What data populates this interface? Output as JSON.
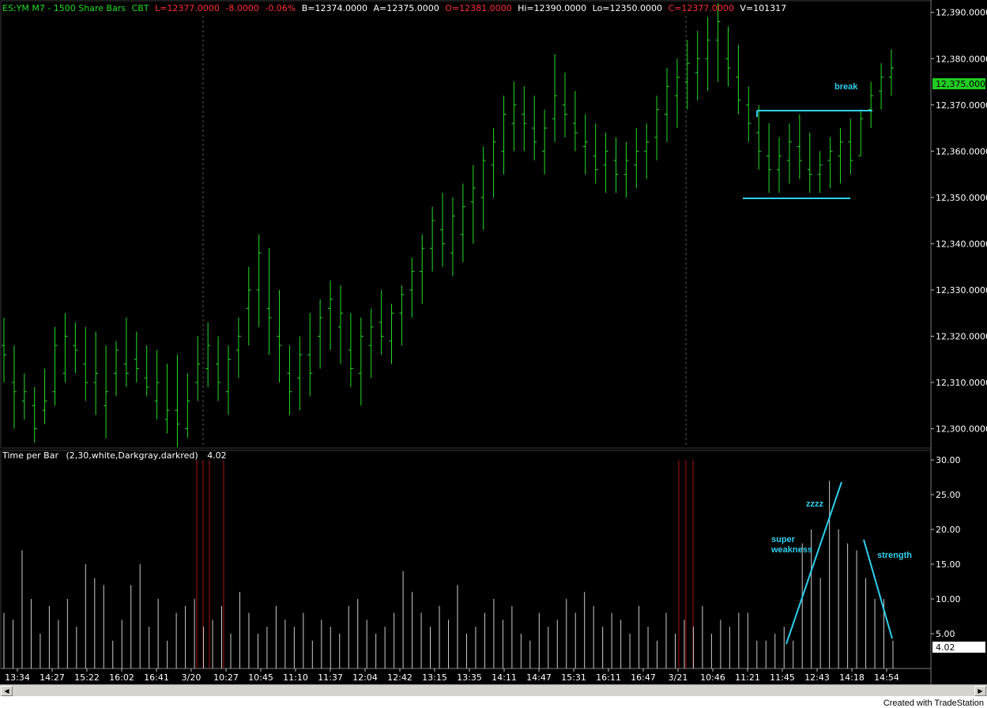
{
  "header": {
    "symbol": "ES:YM M7 - 1500 Share Bars",
    "exchange": "CBT",
    "last": "L=12377.0000",
    "change": "-8.0000",
    "change_pct": "-0.06%",
    "bid": "B=12374.0000",
    "ask": "A=12375.0000",
    "open": "O=12381.0000",
    "high": "Hi=12390.0000",
    "low": "Lo=12350.0000",
    "close": "C=12377.0000",
    "volume": "V=101317"
  },
  "indicator": {
    "label": "Time per Bar",
    "params": "(2,30,white,Darkgray,darkred)",
    "value": "4.02"
  },
  "colors": {
    "background": "#000000",
    "price_bars": "#22dd22",
    "volume_bars": "#cccccc",
    "session_break": "#aa1111",
    "annotation": "#2fd0ee",
    "header_red": "#ff3030",
    "header_green": "#22dd22",
    "last_price_tag": "#22cc22"
  },
  "annotations": {
    "break": "break",
    "zzzz": "zzzz",
    "super": "super",
    "weakness": "weakness",
    "strength": "strength"
  },
  "last_price_tag": "12,375.0000",
  "last_indicator_tag": "4.02",
  "footer": "Created with TradeStation",
  "chart_data": {
    "type": "bar",
    "price_axis": {
      "ylim": [
        12296,
        12392
      ],
      "ticks": [
        "12,390.0000",
        "12,380.0000",
        "12,370.0000",
        "12,360.0000",
        "12,350.0000",
        "12,340.0000",
        "12,330.0000",
        "12,320.0000",
        "12,310.0000",
        "12,300.0000"
      ]
    },
    "indicator_axis": {
      "ylim": [
        0,
        30
      ],
      "ticks": [
        "30.00",
        "25.00",
        "20.00",
        "15.00",
        "10.00",
        "5.00"
      ]
    },
    "time_labels": [
      "13:34",
      "14:27",
      "15:22",
      "16:02",
      "16:41",
      "3/20",
      "10:27",
      "10:45",
      "11:10",
      "11:37",
      "12:04",
      "12:42",
      "13:15",
      "13:35",
      "14:11",
      "14:47",
      "15:31",
      "16:11",
      "16:47",
      "3/21",
      "10:46",
      "11:21",
      "11:45",
      "12:43",
      "14:18",
      "14:54"
    ],
    "ohlc_series": {
      "name": "ES:YM M7",
      "bars": [
        [
          12318,
          12324,
          12310,
          12316
        ],
        [
          12310,
          12318,
          12300,
          12308
        ],
        [
          12306,
          12312,
          12302,
          12308
        ],
        [
          12305,
          12309,
          12297,
          12300
        ],
        [
          12304,
          12313,
          12301,
          12306
        ],
        [
          12308,
          12322,
          12305,
          12318
        ],
        [
          12312,
          12325,
          12310,
          12320
        ],
        [
          12318,
          12323,
          12312,
          12317
        ],
        [
          12314,
          12322,
          12306,
          12310
        ],
        [
          12310,
          12321,
          12303,
          12312
        ],
        [
          12305,
          12318,
          12298,
          12308
        ],
        [
          12312,
          12319,
          12307,
          12317
        ],
        [
          12314,
          12324,
          12309,
          12312
        ],
        [
          12315,
          12321,
          12310,
          12313
        ],
        [
          12311,
          12318,
          12307,
          12309
        ],
        [
          12306,
          12317,
          12302,
          12310
        ],
        [
          12302,
          12314,
          12299,
          12304
        ],
        [
          12304,
          12316,
          12296,
          12301
        ],
        [
          12300,
          12312,
          12298,
          12306
        ],
        [
          12310,
          12320,
          12306,
          12314
        ],
        [
          12313,
          12323,
          12309,
          12318
        ],
        [
          12314,
          12320,
          12306,
          12310
        ],
        [
          12308,
          12318,
          12303,
          12315
        ],
        [
          12317,
          12324,
          12311,
          12320
        ],
        [
          12326,
          12335,
          12318,
          12330
        ],
        [
          12330,
          12342,
          12322,
          12338
        ],
        [
          12326,
          12339,
          12316,
          12324
        ],
        [
          12320,
          12330,
          12310,
          12318
        ],
        [
          12312,
          12318,
          12303,
          12308
        ],
        [
          12311,
          12320,
          12304,
          12316
        ],
        [
          12316,
          12325,
          12307,
          12312
        ],
        [
          12320,
          12328,
          12313,
          12324
        ],
        [
          12326,
          12332,
          12317,
          12328
        ],
        [
          12322,
          12331,
          12314,
          12325
        ],
        [
          12317,
          12325,
          12309,
          12313
        ],
        [
          12312,
          12324,
          12305,
          12320
        ],
        [
          12318,
          12326,
          12311,
          12322
        ],
        [
          12323,
          12330,
          12316,
          12320
        ],
        [
          12319,
          12327,
          12314,
          12325
        ],
        [
          12325,
          12331,
          12318,
          12329
        ],
        [
          12330,
          12337,
          12324,
          12334
        ],
        [
          12334,
          12342,
          12327,
          12339
        ],
        [
          12339,
          12348,
          12334,
          12345
        ],
        [
          12343,
          12351,
          12335,
          12340
        ],
        [
          12338,
          12350,
          12333,
          12346
        ],
        [
          12342,
          12353,
          12336,
          12348
        ],
        [
          12349,
          12357,
          12340,
          12352
        ],
        [
          12350,
          12361,
          12343,
          12358
        ],
        [
          12357,
          12365,
          12350,
          12362
        ],
        [
          12360,
          12372,
          12355,
          12368
        ],
        [
          12366,
          12375,
          12360,
          12370
        ],
        [
          12368,
          12374,
          12360,
          12366
        ],
        [
          12365,
          12372,
          12358,
          12362
        ],
        [
          12360,
          12369,
          12355,
          12365
        ],
        [
          12367,
          12381,
          12362,
          12372
        ],
        [
          12370,
          12377,
          12363,
          12368
        ],
        [
          12366,
          12373,
          12360,
          12364
        ],
        [
          12361,
          12368,
          12355,
          12362
        ],
        [
          12359,
          12366,
          12353,
          12356
        ],
        [
          12357,
          12364,
          12351,
          12360
        ],
        [
          12358,
          12363,
          12351,
          12355
        ],
        [
          12355,
          12362,
          12350,
          12358
        ],
        [
          12357,
          12365,
          12352,
          12360
        ],
        [
          12360,
          12366,
          12354,
          12362
        ],
        [
          12363,
          12372,
          12358,
          12369
        ],
        [
          12368,
          12378,
          12362,
          12374
        ],
        [
          12372,
          12380,
          12365,
          12376
        ],
        [
          12375,
          12384,
          12369,
          12379
        ],
        [
          12377,
          12386,
          12371,
          12380
        ],
        [
          12380,
          12389,
          12373,
          12384
        ],
        [
          12384,
          12392,
          12375,
          12388
        ],
        [
          12380,
          12387,
          12374,
          12378
        ],
        [
          12376,
          12383,
          12368,
          12371
        ],
        [
          12370,
          12374,
          12362,
          12366
        ],
        [
          12364,
          12370,
          12356,
          12360
        ],
        [
          12359,
          12366,
          12351,
          12356
        ],
        [
          12356,
          12363,
          12351,
          12359
        ],
        [
          12358,
          12366,
          12353,
          12362
        ],
        [
          12361,
          12368,
          12354,
          12358
        ],
        [
          12356,
          12364,
          12351,
          12355
        ],
        [
          12355,
          12360,
          12351,
          12357
        ],
        [
          12358,
          12363,
          12352,
          12360
        ],
        [
          12359,
          12365,
          12353,
          12362
        ],
        [
          12362,
          12367,
          12355,
          12358
        ],
        [
          12359,
          12369,
          12359,
          12367
        ],
        [
          12369,
          12375,
          12365,
          12372
        ],
        [
          12373,
          12379,
          12369,
          12376
        ],
        [
          12376,
          12382,
          12372,
          12378
        ]
      ]
    },
    "time_per_bar_series": {
      "values": [
        8,
        7,
        17,
        10,
        5,
        9,
        7,
        10,
        6,
        15,
        13,
        12,
        4,
        7,
        12,
        15,
        6,
        10,
        4,
        8,
        9,
        10,
        6,
        7,
        9,
        5,
        11,
        8,
        5,
        6,
        9,
        7,
        6,
        8,
        4,
        7,
        6,
        5,
        9,
        10,
        7,
        5,
        6,
        8,
        14,
        11,
        8,
        6,
        9,
        7,
        12,
        5,
        6,
        8,
        10,
        7,
        9,
        5,
        4,
        8,
        6,
        7,
        10,
        8,
        11,
        9,
        6,
        8,
        7,
        5,
        9,
        6,
        4,
        8,
        5,
        7,
        6,
        9,
        5,
        7,
        6,
        8,
        8,
        4,
        4,
        5,
        6,
        4,
        18,
        20,
        13,
        27,
        20,
        18,
        17,
        13,
        10,
        10,
        4
      ],
      "session_breaks": [
        5,
        19
      ]
    },
    "levels": [
      {
        "label": "break",
        "value": 12369
      },
      {
        "label": "",
        "value": 12350
      }
    ]
  }
}
